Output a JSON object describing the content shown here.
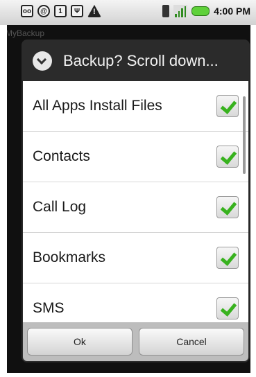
{
  "status_bar": {
    "notification_icons": [
      "voicemail-icon",
      "at-sign-icon",
      "calendar-icon",
      "usb-icon",
      "warning-icon"
    ],
    "calendar_day": "1",
    "time": "4:00 PM"
  },
  "app": {
    "title": "MyBackup"
  },
  "dialog": {
    "title": "Backup? Scroll down...",
    "items": [
      {
        "label": "All Apps Install Files",
        "checked": true
      },
      {
        "label": "Contacts",
        "checked": true
      },
      {
        "label": "Call Log",
        "checked": true
      },
      {
        "label": "Bookmarks",
        "checked": true
      },
      {
        "label": "SMS",
        "checked": true
      }
    ],
    "ok_label": "Ok",
    "cancel_label": "Cancel"
  },
  "colors": {
    "check_green": "#38b21e",
    "dialog_header": "#2b2b2b"
  }
}
